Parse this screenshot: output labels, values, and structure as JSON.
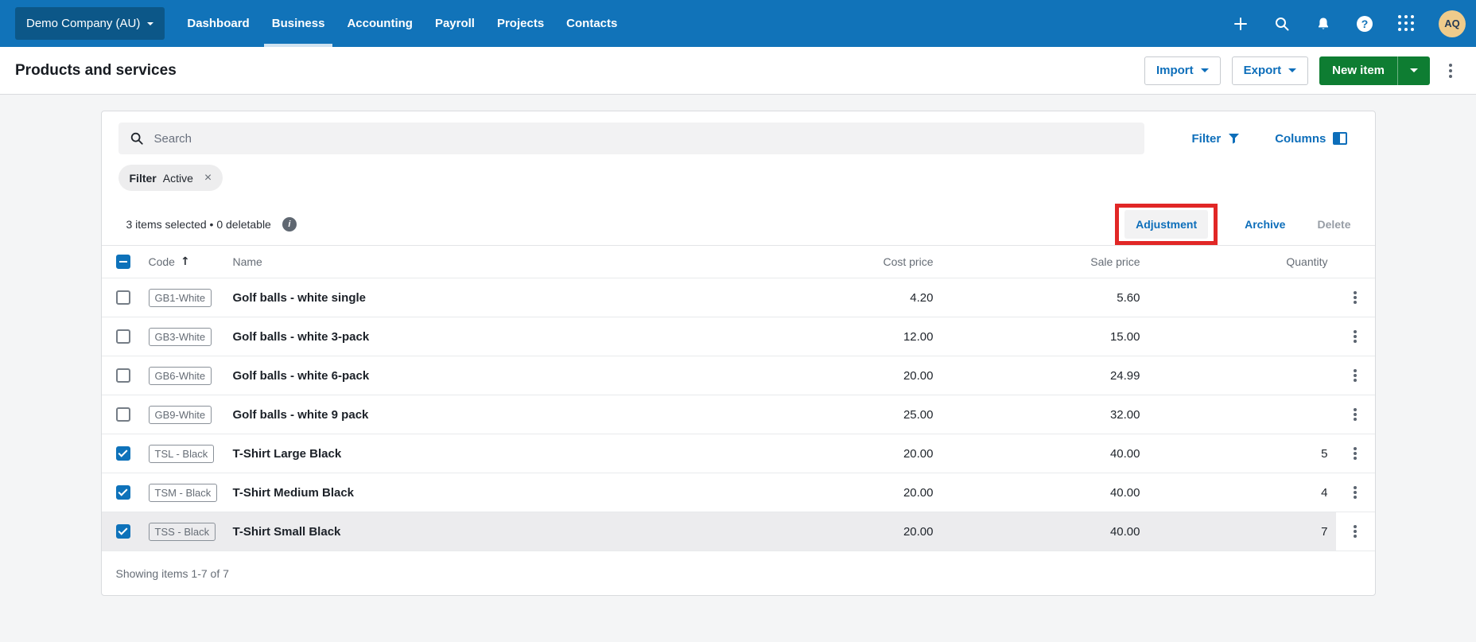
{
  "nav": {
    "company": "Demo Company (AU)",
    "items": [
      "Dashboard",
      "Business",
      "Accounting",
      "Payroll",
      "Projects",
      "Contacts"
    ],
    "active_item": "Business",
    "icons": [
      "plus-icon",
      "search-icon",
      "bell-icon",
      "help-icon",
      "apps-grid-icon"
    ],
    "avatar_initials": "AQ"
  },
  "header": {
    "title": "Products and services",
    "import_label": "Import",
    "export_label": "Export",
    "new_item_label": "New item"
  },
  "toolbar": {
    "search_placeholder": "Search",
    "filter_label": "Filter",
    "columns_label": "Columns",
    "chip": {
      "label": "Filter",
      "value": "Active",
      "close": "×"
    }
  },
  "selection_bar": {
    "text": "3 items selected • 0 deletable",
    "adjustment_label": "Adjustment",
    "archive_label": "Archive",
    "delete_label": "Delete"
  },
  "table": {
    "columns": [
      "Code",
      "Name",
      "Cost price",
      "Sale price",
      "Quantity"
    ],
    "sort_arrow": "↑",
    "rows": [
      {
        "code": "GB1-White",
        "name": "Golf balls - white single",
        "cost": "4.20",
        "sale": "5.60",
        "qty": "",
        "checked": false,
        "highlighted": false
      },
      {
        "code": "GB3-White",
        "name": "Golf balls - white 3-pack",
        "cost": "12.00",
        "sale": "15.00",
        "qty": "",
        "checked": false,
        "highlighted": false
      },
      {
        "code": "GB6-White",
        "name": "Golf balls - white 6-pack",
        "cost": "20.00",
        "sale": "24.99",
        "qty": "",
        "checked": false,
        "highlighted": false
      },
      {
        "code": "GB9-White",
        "name": "Golf balls - white 9 pack",
        "cost": "25.00",
        "sale": "32.00",
        "qty": "",
        "checked": false,
        "highlighted": false
      },
      {
        "code": "TSL - Black",
        "name": "T-Shirt Large Black",
        "cost": "20.00",
        "sale": "40.00",
        "qty": "5",
        "checked": true,
        "highlighted": false
      },
      {
        "code": "TSM - Black",
        "name": "T-Shirt Medium Black",
        "cost": "20.00",
        "sale": "40.00",
        "qty": "4",
        "checked": true,
        "highlighted": false
      },
      {
        "code": "TSS - Black",
        "name": "T-Shirt Small Black",
        "cost": "20.00",
        "sale": "40.00",
        "qty": "7",
        "checked": true,
        "highlighted": true
      }
    ],
    "footer": "Showing items 1-7 of 7"
  },
  "colors": {
    "nav_blue": "#1173b9",
    "org_box_blue": "#0c5788",
    "link_blue": "#0d6eba",
    "button_green": "#0e7d32",
    "annotation_red": "#e12726",
    "checkbox_blue": "#0e72ba",
    "avatar_bg": "#efcb8b",
    "highlight_row": "#ececee"
  }
}
